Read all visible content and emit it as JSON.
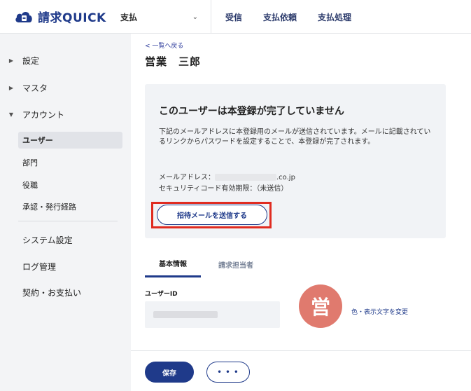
{
  "header": {
    "logo_text": "請求QUICK",
    "app_switch_label": "支払",
    "nav": [
      "受信",
      "支払依頼",
      "支払処理"
    ]
  },
  "sidebar": {
    "groups": [
      {
        "label": "設定",
        "arrow": "▶"
      },
      {
        "label": "マスタ",
        "arrow": "▶"
      },
      {
        "label": "アカウント",
        "arrow": "▼"
      }
    ],
    "sub_items": [
      "ユーザー",
      "部門",
      "役職",
      "承認・発行経路"
    ],
    "items": [
      "システム設定",
      "ログ管理",
      "契約・お支払い"
    ]
  },
  "main": {
    "back_link": "< 一覧へ戻る",
    "title": "営業　三郎",
    "notice": {
      "heading": "このユーザーは本登録が完了していません",
      "description": "下記のメールアドレスに本登録用のメールが送信されています。メールに記載されているリンクからパスワードを設定することで、本登録が完了されます。",
      "email_label": "メールアドレス：",
      "email_suffix": ".co.jp",
      "security_label": "セキュリティコード有効期限：（未送信）",
      "invite_button": "招待メールを送信する"
    },
    "tabs": [
      "基本情報",
      "請求担当者"
    ],
    "user_id_label": "ユーザーID",
    "avatar_text": "営",
    "color_link": "色・表示文字を変更"
  },
  "footer": {
    "save_label": "保存",
    "more_label": "• • •"
  },
  "colors": {
    "brand": "#1f3a8a",
    "highlight": "#e02b20",
    "avatar": "#e07a6e"
  }
}
